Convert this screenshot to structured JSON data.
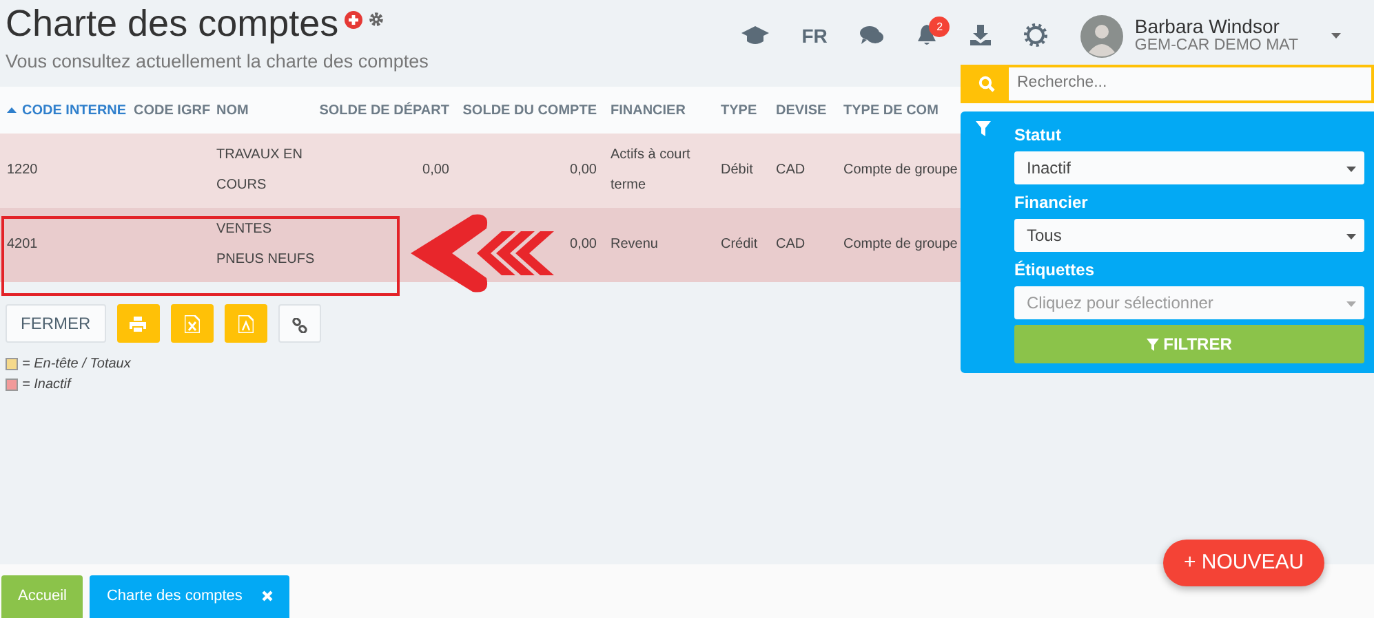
{
  "header": {
    "title": "Charte des comptes",
    "subtitle": "Vous consultez actuellement la charte des comptes",
    "language": "FR",
    "notifications": "2",
    "user": {
      "name": "Barbara Windsor",
      "company": "GEM-CAR DEMO MAT"
    }
  },
  "table": {
    "columns": [
      {
        "label": "CODE INTERNE",
        "sorted": true
      },
      {
        "label": "CODE IGRF",
        "sorted": false
      },
      {
        "label": "NOM",
        "sorted": false
      },
      {
        "label": "SOLDE DE DÉPART",
        "sorted": false
      },
      {
        "label": "SOLDE DU COMPTE",
        "sorted": false
      },
      {
        "label": "FINANCIER",
        "sorted": false
      },
      {
        "label": "TYPE",
        "sorted": false
      },
      {
        "label": "DEVISE",
        "sorted": false
      },
      {
        "label": "TYPE DE COM",
        "sorted": false
      }
    ],
    "rows": [
      {
        "inactive": true,
        "highlighted": false,
        "cells": [
          "1220",
          "",
          "TRAVAUX EN\nCOURS",
          "0,00",
          "0,00",
          "Actifs à court\nterme",
          "Débit",
          "CAD",
          "Compte de groupe"
        ]
      },
      {
        "inactive": true,
        "highlighted": true,
        "cells": [
          "4201",
          "",
          "VENTES\nPNEUS NEUFS",
          "",
          "0,00",
          "Revenu",
          "Crédit",
          "CAD",
          "Compte de groupe"
        ]
      }
    ]
  },
  "actions": {
    "close_label": "FERMER"
  },
  "legend": [
    {
      "label": "= En-tête / Totaux",
      "color": "#f5d98b"
    },
    {
      "label": "= Inactif",
      "color": "#f29a9a"
    }
  ],
  "filter_panel": {
    "search_placeholder": "Recherche...",
    "fields": [
      {
        "label": "Statut",
        "value": "Inactif"
      },
      {
        "label": "Financier",
        "value": "Tous"
      },
      {
        "label": "Étiquettes",
        "placeholder": "Cliquez pour sélectionner"
      }
    ],
    "button": "FILTRER"
  },
  "new_button": "+ NOUVEAU",
  "tabs": [
    {
      "label": "Accueil",
      "selected": false,
      "closable": false
    },
    {
      "label": "Charte des comptes",
      "selected": true,
      "closable": true
    }
  ]
}
